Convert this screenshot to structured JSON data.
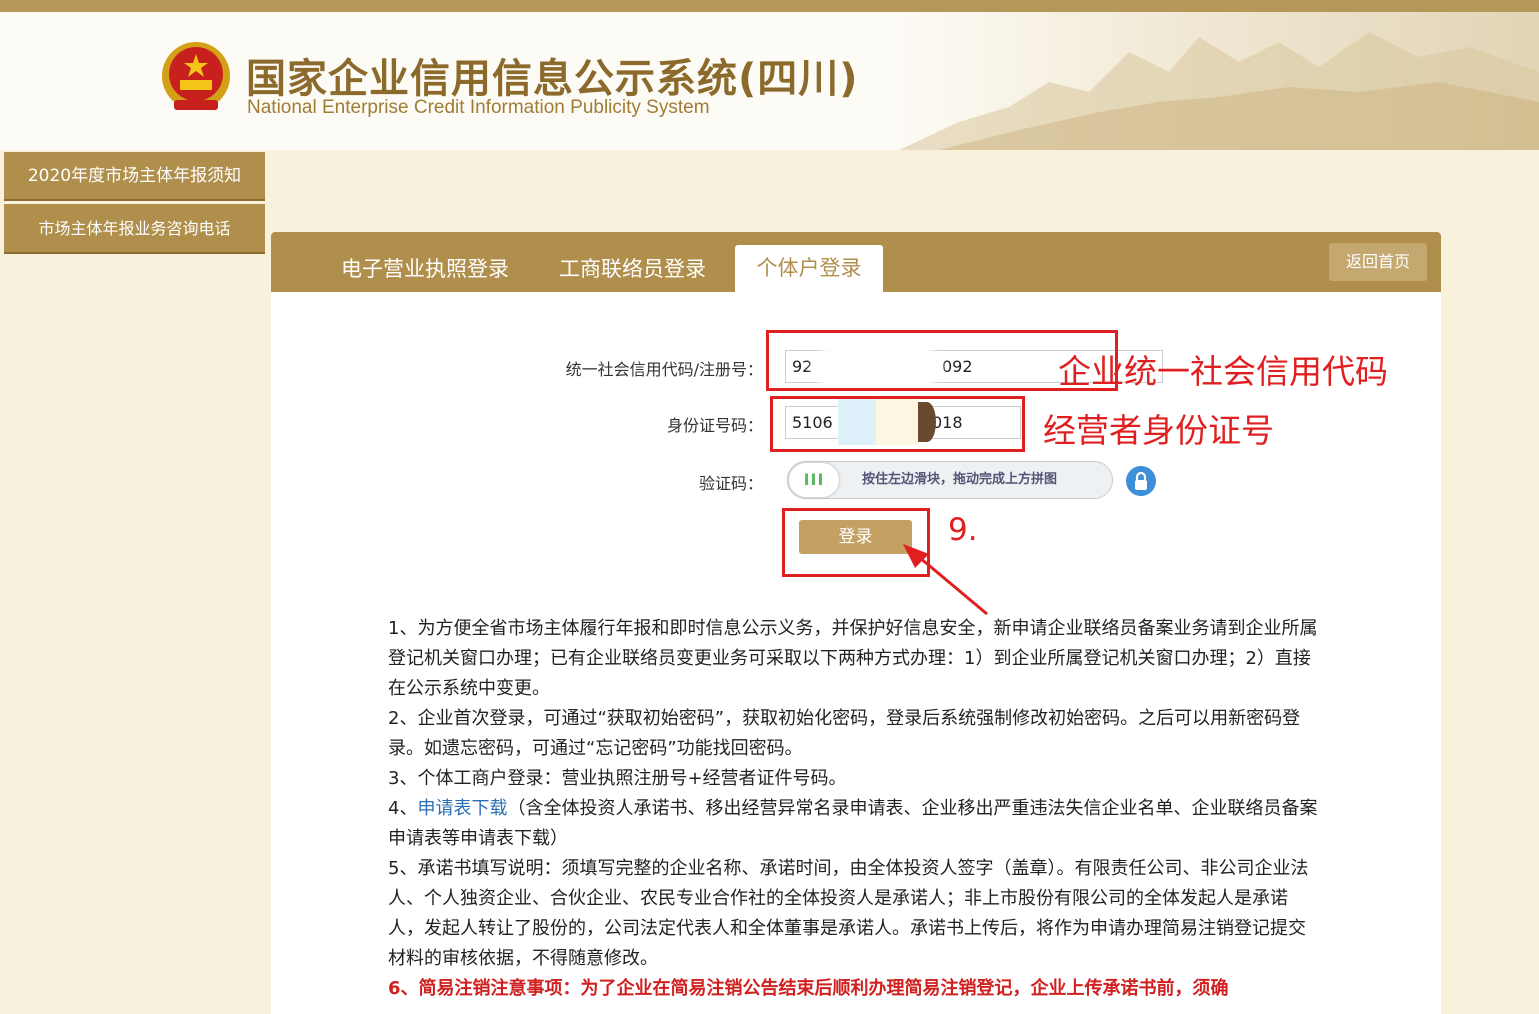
{
  "header": {
    "title": "国家企业信用信息公示系统(四川)",
    "subtitle": "National Enterprise Credit Information Publicity System"
  },
  "sidebar": {
    "items": [
      {
        "label": "2020年度市场主体年报须知"
      },
      {
        "label": "市场主体年报业务咨询电话"
      }
    ]
  },
  "tabs": [
    {
      "label": "电子营业执照登录",
      "active": false
    },
    {
      "label": "工商联络员登录",
      "active": false
    },
    {
      "label": "个体户登录",
      "active": true
    }
  ],
  "home_button": "返回首页",
  "form": {
    "credit_code_label": "统一社会信用代码/注册号：",
    "credit_code_prefix": "92",
    "credit_code_suffix": "092",
    "id_label": "身份证号码：",
    "id_prefix": "5106",
    "id_suffix": "018",
    "captcha_label": "验证码：",
    "slider_hint": "按住左边滑块，拖动完成上方拼图",
    "slider_knob": "III",
    "login_button": "登录"
  },
  "annotations": {
    "credit_code": "企业统一社会信用代码",
    "id_number": "经营者身份证号",
    "step": "9."
  },
  "notes": {
    "n1": "1、为方便全省市场主体履行年报和即时信息公示义务，并保护好信息安全，新申请企业联络员备案业务请到企业所属登记机关窗口办理；已有企业联络员变更业务可采取以下两种方式办理：1）到企业所属登记机关窗口办理；2）直接在公示系统中变更。",
    "n2": "2、企业首次登录，可通过“获取初始密码”，获取初始化密码，登录后系统强制修改初始密码。之后可以用新密码登录。如遗忘密码，可通过“忘记密码”功能找回密码。",
    "n3": "3、个体工商户登录：营业执照注册号+经营者证件号码。",
    "n4_prefix": "4、",
    "n4_link": "申请表下载",
    "n4_rest": "（含全体投资人承诺书、移出经营异常名录申请表、企业移出严重违法失信企业名单、企业联络员备案申请表等申请表下载）",
    "n5": "5、承诺书填写说明：须填写完整的企业名称、承诺时间，由全体投资人签字（盖章）。有限责任公司、非公司企业法人、个人独资企业、合伙企业、农民专业合作社的全体投资人是承诺人；非上市股份有限公司的全体发起人是承诺人，发起人转让了股份的，公司法定代表人和全体董事是承诺人。承诺书上传后，将作为申请办理简易注销登记提交材料的审核依据，不得随意修改。",
    "n6": "6、简易注销注意事项：为了企业在简易注销公告结束后顺利办理简易注销登记，企业上传承诺书前，须确"
  },
  "colors": {
    "brand": "#b08f4c",
    "annotation": "#e02020",
    "link": "#2a6fb6"
  }
}
